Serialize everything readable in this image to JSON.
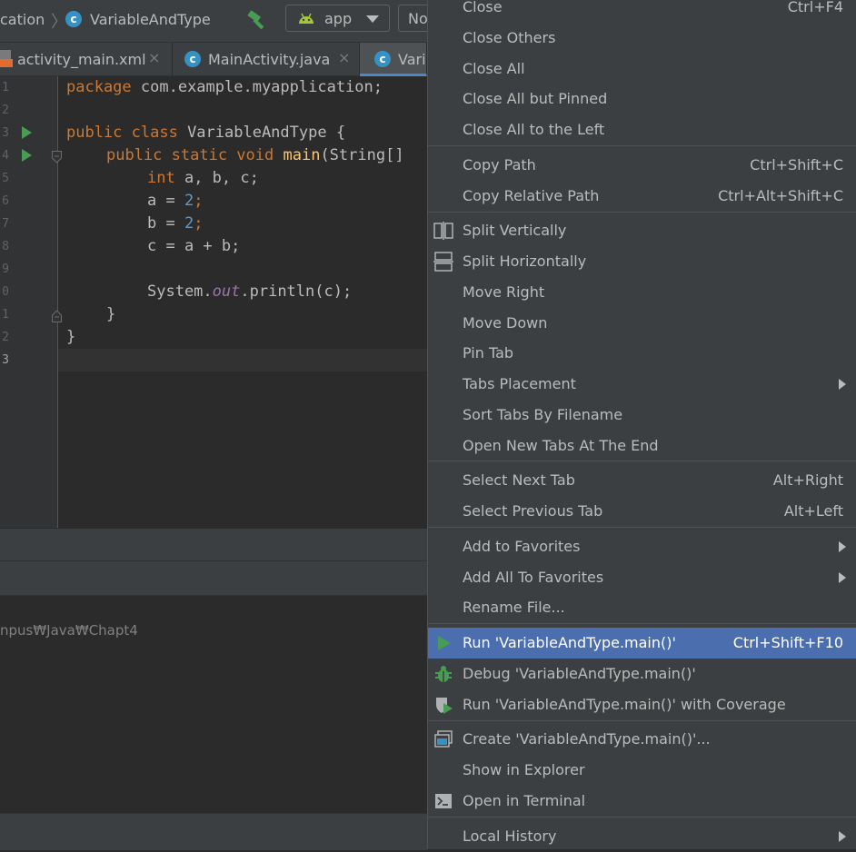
{
  "navbar": {
    "crumb_project": "cation",
    "crumb_file": "VariableAndType",
    "class_icon_letter": "c",
    "run_config": "app",
    "device_partial": "No"
  },
  "tabs": [
    {
      "label": "activity_main.xml",
      "close": "×"
    },
    {
      "label": "MainActivity.java",
      "close": "×"
    },
    {
      "label": "Vari"
    }
  ],
  "editor": {
    "line_numbers": [
      "1",
      "2",
      "3",
      "4",
      "5",
      "6",
      "7",
      "8",
      "9",
      "0",
      "1",
      "2",
      "3"
    ],
    "lines": {
      "l1_kw": "package",
      "l1_rest": " com.example.myapplication;",
      "l3_kw": "public class",
      "l3_rest": " VariableAndType {",
      "l4_kw": "public static void",
      "l4_fn": "main",
      "l4_rest": "(String[]",
      "l5_kw": "int",
      "l5_rest": " a, b, c;",
      "l6_a": "a = ",
      "l6_num": "2",
      "l6_end": ";",
      "l7_a": "b = ",
      "l7_num": "2",
      "l7_end": ";",
      "l8": "c = a + b;",
      "l10_a": "System.",
      "l10_fld": "out",
      "l10_b": ".println(c);",
      "l11": "}",
      "l12": "}"
    }
  },
  "bottom": {
    "path_text": "npus₩Java₩Chapt4"
  },
  "menu": {
    "items": [
      {
        "label": "Close",
        "shortcut": "Ctrl+F4"
      },
      {
        "label": "Close Others"
      },
      {
        "label": "Close All"
      },
      {
        "label": "Close All but Pinned"
      },
      {
        "label": "Close All to the Left"
      },
      {
        "label": "Copy Path",
        "shortcut": "Ctrl+Shift+C"
      },
      {
        "label": "Copy Relative Path",
        "shortcut": "Ctrl+Alt+Shift+C"
      },
      {
        "label": "Split Vertically",
        "icon": "split-vertically-icon"
      },
      {
        "label": "Split Horizontally",
        "icon": "split-horizontally-icon"
      },
      {
        "label": "Move Right"
      },
      {
        "label": "Move Down"
      },
      {
        "label": "Pin Tab"
      },
      {
        "label": "Tabs Placement",
        "submenu": true
      },
      {
        "label": "Sort Tabs By Filename"
      },
      {
        "label": "Open New Tabs At The End"
      },
      {
        "label": "Select Next Tab",
        "shortcut": "Alt+Right"
      },
      {
        "label": "Select Previous Tab",
        "shortcut": "Alt+Left"
      },
      {
        "label": "Add to Favorites",
        "submenu": true
      },
      {
        "label": "Add All To Favorites",
        "submenu": true
      },
      {
        "label": "Rename File..."
      },
      {
        "label": "Run 'VariableAndType.main()'",
        "shortcut": "Ctrl+Shift+F10",
        "icon": "run-icon",
        "selected": true
      },
      {
        "label": "Debug 'VariableAndType.main()'",
        "icon": "debug-icon"
      },
      {
        "label": "Run 'VariableAndType.main()' with Coverage",
        "icon": "coverage-icon"
      },
      {
        "label": "Create 'VariableAndType.main()'...",
        "icon": "run-config-icon"
      },
      {
        "label": "Show in Explorer"
      },
      {
        "label": "Open in Terminal",
        "icon": "terminal-icon"
      },
      {
        "label": "Local History",
        "submenu": true
      }
    ]
  },
  "colors": {
    "menu_bg": "#3c3f41",
    "selection": "#4b6eaf",
    "keyword": "#cc7832",
    "function": "#ffc66d",
    "number": "#6897bb",
    "field": "#9876aa",
    "run_green": "#499c54"
  }
}
